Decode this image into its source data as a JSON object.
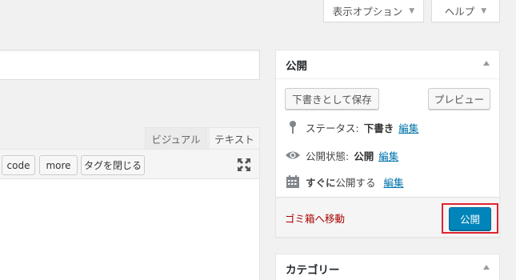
{
  "screen_meta": {
    "options_label": "表示オプション",
    "help_label": "ヘルプ"
  },
  "editor": {
    "tab_visual": "ビジュアル",
    "tab_text": "テキスト",
    "quicktags": [
      "code",
      "more",
      "タグを閉じる"
    ]
  },
  "publish_box": {
    "title": "公開",
    "save_draft_label": "下書きとして保存",
    "preview_label": "プレビュー",
    "status_label": "ステータス:",
    "status_value": "下書き",
    "visibility_label": "公開状態:",
    "visibility_value": "公開",
    "schedule_prefix": "すぐに",
    "schedule_suffix": "公開する",
    "edit_link": "編集",
    "trash_label": "ゴミ箱へ移動",
    "publish_label": "公開"
  },
  "category_box": {
    "title": "カテゴリー"
  },
  "colors": {
    "primary": "#0085ba",
    "danger": "#a00",
    "highlight": "#e0242f",
    "link": "#0073aa"
  }
}
